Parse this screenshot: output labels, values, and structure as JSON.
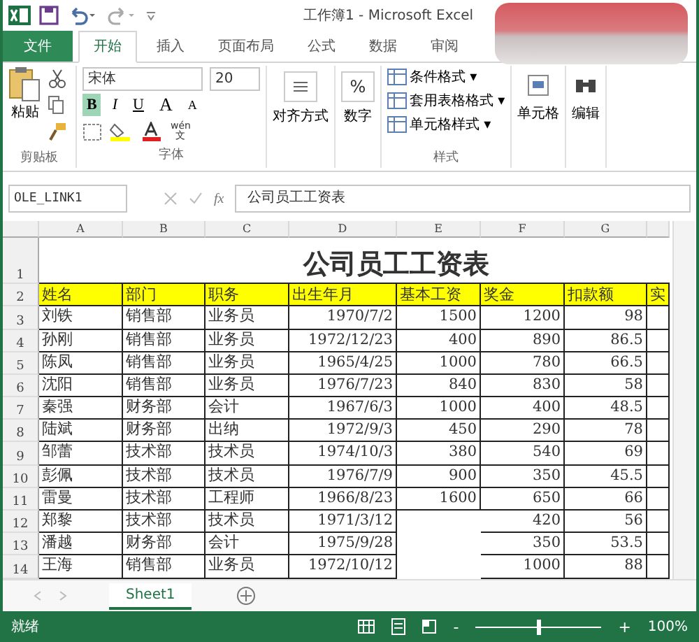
{
  "window": {
    "title": "工作簿1 - Microsoft Excel"
  },
  "tabs": [
    {
      "label": "文件",
      "kind": "file",
      "selected": false
    },
    {
      "label": "开始",
      "kind": "tab",
      "selected": true
    },
    {
      "label": "插入",
      "kind": "tab",
      "selected": false
    },
    {
      "label": "页面布局",
      "kind": "tab",
      "selected": false
    },
    {
      "label": "公式",
      "kind": "tab",
      "selected": false
    },
    {
      "label": "数据",
      "kind": "tab",
      "selected": false
    },
    {
      "label": "审阅",
      "kind": "tab",
      "selected": false
    }
  ],
  "ribbon": {
    "paste": "粘贴",
    "clipboard_label": "剪贴板",
    "font_name": "宋体",
    "font_size": "20",
    "format_buttons": [
      {
        "label": "B",
        "kind": "bold",
        "on": true
      },
      {
        "label": "I",
        "kind": "italic",
        "on": false
      },
      {
        "label": "U",
        "kind": "underline",
        "on": false
      }
    ],
    "grow": "A",
    "shrink": "A",
    "phonetic": "wén",
    "phonetic_sub": "文",
    "font_label": "字体",
    "align": "对齐方式",
    "number_symbol": "%",
    "number": "数字",
    "styles": [
      "条件格式 ▾",
      "套用表格格式 ▾",
      "单元格样式 ▾"
    ],
    "styles_label": "样式",
    "cells": "单元格",
    "editing": "编辑"
  },
  "formula_bar": {
    "name_box": "OLE_LINK1",
    "fx": "fx",
    "value": "公司员工工资表"
  },
  "sheet": {
    "columns": [
      "A",
      "B",
      "C",
      "D",
      "E",
      "F",
      "G"
    ],
    "title_row": "1",
    "header_row": "2",
    "title": "公司员工工资表",
    "headers": [
      "姓名",
      "部门",
      "职务",
      "出生年月",
      "基本工资",
      "奖金",
      "扣款额",
      "实"
    ],
    "rows": [
      {
        "n": "3",
        "cells": [
          "刘铁",
          "销售部",
          "业务员",
          "1970/7/2",
          "1500",
          "1200",
          "98"
        ]
      },
      {
        "n": "4",
        "cells": [
          "孙刚",
          "销售部",
          "业务员",
          "1972/12/23",
          "400",
          "890",
          "86.5"
        ]
      },
      {
        "n": "5",
        "cells": [
          "陈凤",
          "销售部",
          "业务员",
          "1965/4/25",
          "1000",
          "780",
          "66.5"
        ]
      },
      {
        "n": "6",
        "cells": [
          "沈阳",
          "销售部",
          "业务员",
          "1976/7/23",
          "840",
          "830",
          "58"
        ]
      },
      {
        "n": "7",
        "cells": [
          "秦强",
          "财务部",
          "会计",
          "1967/6/3",
          "1000",
          "400",
          "48.5"
        ]
      },
      {
        "n": "8",
        "cells": [
          "陆斌",
          "财务部",
          "出纳",
          "1972/9/3",
          "450",
          "290",
          "78"
        ]
      },
      {
        "n": "9",
        "cells": [
          "邹蕾",
          "技术部",
          "技术员",
          "1974/10/3",
          "380",
          "540",
          "69"
        ]
      },
      {
        "n": "10",
        "cells": [
          "彭佩",
          "技术部",
          "技术员",
          "1976/7/9",
          "900",
          "350",
          "45.5"
        ]
      },
      {
        "n": "11",
        "cells": [
          "雷曼",
          "技术部",
          "工程师",
          "1966/8/23",
          "1600",
          "650",
          "66"
        ]
      },
      {
        "n": "12",
        "cells": [
          "郑黎",
          "技术部",
          "技术员",
          "1971/3/12",
          null,
          "420",
          "56"
        ]
      },
      {
        "n": "13",
        "cells": [
          "潘越",
          "财务部",
          "会计",
          "1975/9/28",
          null,
          "350",
          "53.5"
        ]
      },
      {
        "n": "14",
        "cells": [
          "王海",
          "销售部",
          "业务员",
          "1972/10/12",
          null,
          "1000",
          "88"
        ]
      }
    ]
  },
  "sheet_tabs": [
    {
      "label": "Sheet1",
      "selected": true
    }
  ],
  "status_bar": {
    "text": "就绪",
    "zoom_minus": "-",
    "zoom_plus": "+",
    "zoom": {
      "level": 0.5
    },
    "zoom_text": "100%"
  }
}
